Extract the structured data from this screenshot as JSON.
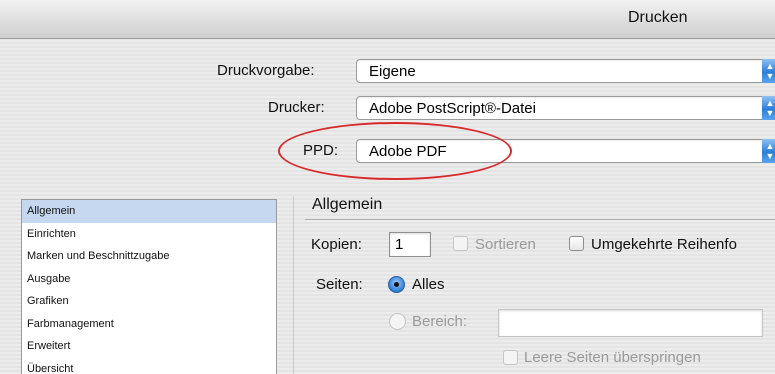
{
  "window": {
    "title": "Drucken"
  },
  "top": {
    "preset": {
      "label": "Druckvorgabe:",
      "value": "Eigene"
    },
    "printer": {
      "label": "Drucker:",
      "value": "Adobe PostScript®-Datei"
    },
    "ppd": {
      "label": "PPD:",
      "value": "Adobe PDF"
    }
  },
  "sidebar": {
    "items": [
      {
        "label": "Allgemein",
        "selected": true
      },
      {
        "label": "Einrichten"
      },
      {
        "label": "Marken und Beschnittzugabe"
      },
      {
        "label": "Ausgabe"
      },
      {
        "label": "Grafiken"
      },
      {
        "label": "Farbmanagement"
      },
      {
        "label": "Erweitert"
      },
      {
        "label": "Übersicht"
      }
    ]
  },
  "general": {
    "title": "Allgemein",
    "copies_label": "Kopien:",
    "copies_value": "1",
    "collate_label": "Sortieren",
    "reverse_label": "Umgekehrte Reihenfo",
    "pages_label": "Seiten:",
    "all_label": "Alles",
    "range_label": "Bereich:",
    "range_value": "",
    "skip_blank_label": "Leere Seiten überspringen"
  },
  "colors": {
    "highlight": "#d82a2a",
    "accent": "#2b7fd8"
  }
}
